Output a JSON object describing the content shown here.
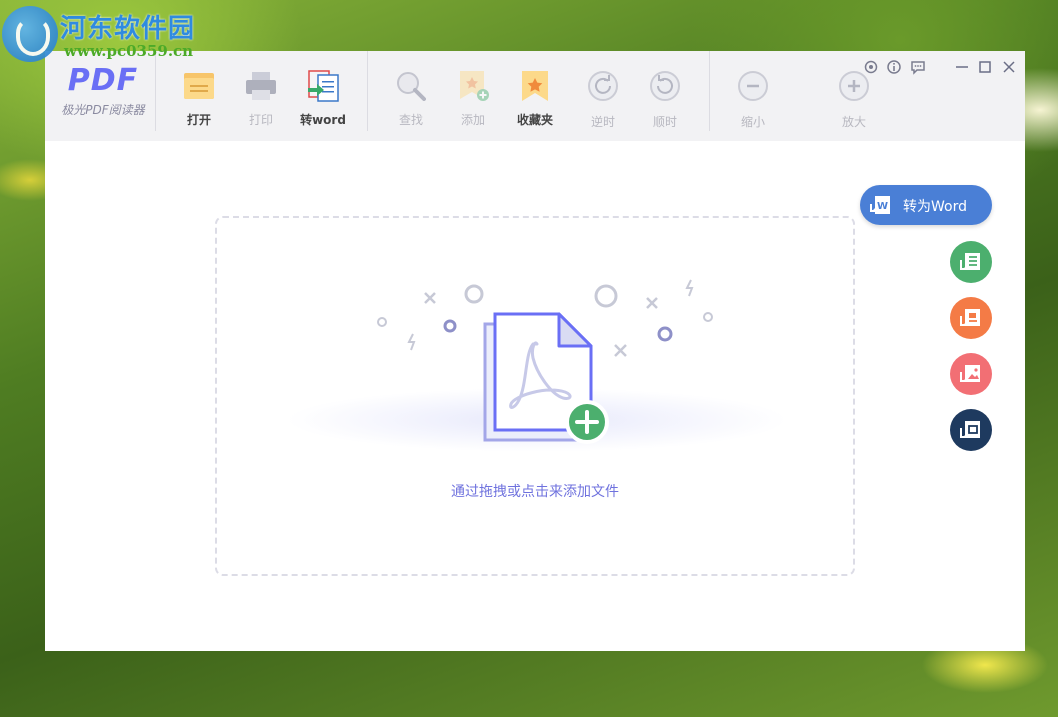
{
  "watermark": {
    "title": "河东软件园",
    "url": "www.pc0359.cn"
  },
  "app": {
    "logo_text": "PDF",
    "name": "极光PDF阅读器"
  },
  "toolbar": {
    "open": "打开",
    "print": "打印",
    "to_word": "转word",
    "find": "查找",
    "add": "添加",
    "favorites": "收藏夹",
    "rotate_ccw": "逆时",
    "rotate_cw": "顺时",
    "zoom_out": "缩小",
    "zoom_in": "放大"
  },
  "main": {
    "drop_hint": "通过拖拽或点击来添加文件"
  },
  "convert": {
    "word_label": "转为Word",
    "colors": {
      "word": "#4a7fd6",
      "excel": "#4caf6e",
      "ppt": "#f47b46",
      "image": "#f26f74",
      "pdf": "#1e3a5f"
    }
  },
  "accent": "#6a6ff5"
}
